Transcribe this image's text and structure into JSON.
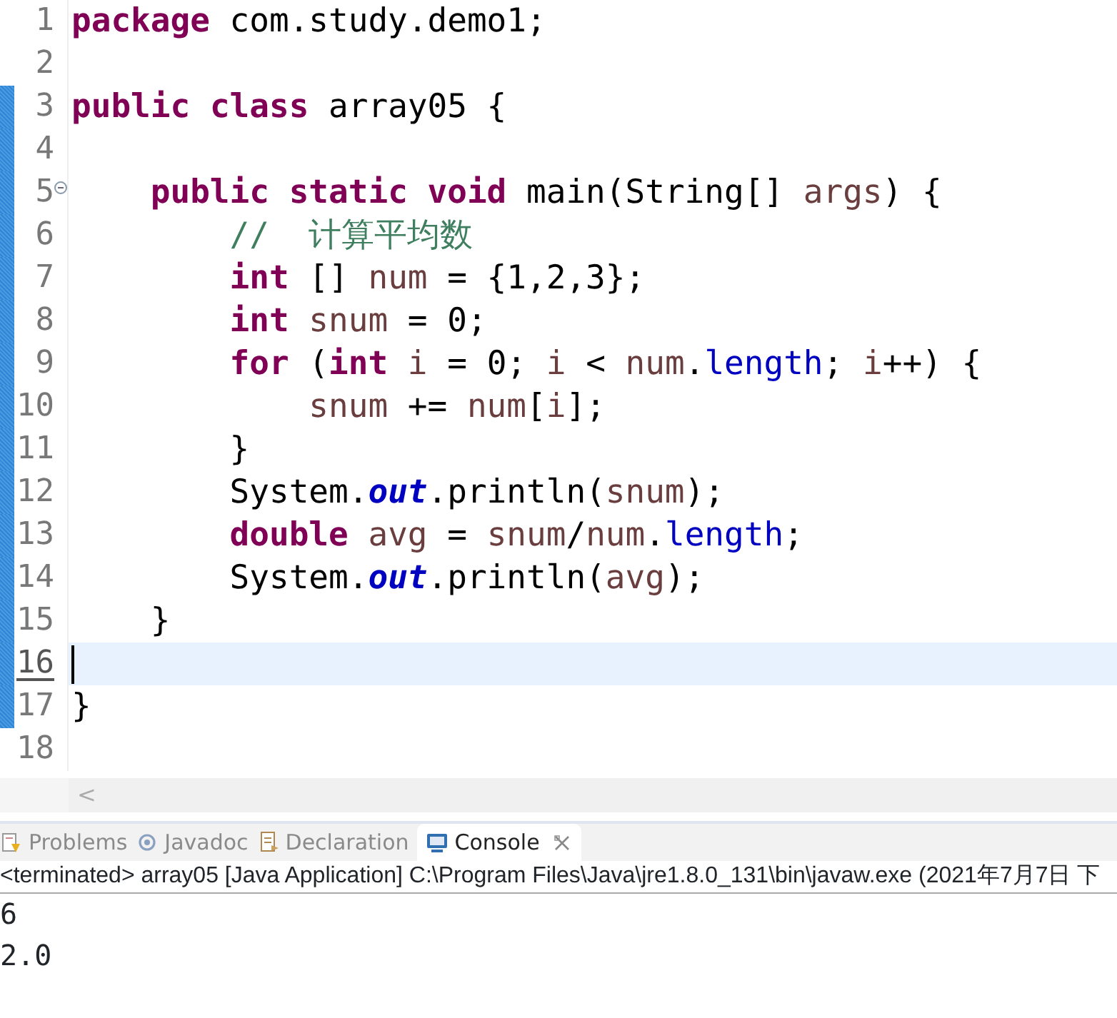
{
  "editor": {
    "lines": [
      {
        "number": "1",
        "marked": false,
        "current": false,
        "fold": false,
        "tokens": [
          {
            "kind": "keyword",
            "text": "package"
          },
          {
            "kind": "plain",
            "text": " com.study.demo1;"
          }
        ]
      },
      {
        "number": "2",
        "marked": false,
        "current": false,
        "fold": false
      },
      {
        "number": "3",
        "marked": true,
        "current": false,
        "fold": false,
        "tokens": [
          {
            "kind": "keyword",
            "text": "public"
          },
          {
            "kind": "keyword",
            "text": " class"
          },
          {
            "kind": "plain",
            "text": " array05 {"
          }
        ]
      },
      {
        "number": "4",
        "marked": true,
        "current": false,
        "fold": false
      },
      {
        "number": "5",
        "marked": true,
        "current": false,
        "fold": true,
        "tokens": [
          {
            "kind": "keyword",
            "text": "    public"
          },
          {
            "kind": "keyword",
            "text": " static"
          },
          {
            "kind": "keyword",
            "text": " void"
          },
          {
            "kind": "plain",
            "text": " main(String[] "
          },
          {
            "kind": "local",
            "text": "args"
          },
          {
            "kind": "plain",
            "text": ") {"
          }
        ]
      },
      {
        "number": "6",
        "marked": true,
        "current": false,
        "fold": false,
        "tokens": [
          {
            "kind": "comment",
            "text": "        //  计算平均数"
          }
        ]
      },
      {
        "number": "7",
        "marked": true,
        "current": false,
        "fold": false,
        "tokens": [
          {
            "kind": "keyword",
            "text": "        int"
          },
          {
            "kind": "plain",
            "text": " [] "
          },
          {
            "kind": "local",
            "text": "num"
          },
          {
            "kind": "plain",
            "text": " = {1,2,3};"
          }
        ]
      },
      {
        "number": "8",
        "marked": true,
        "current": false,
        "fold": false,
        "tokens": [
          {
            "kind": "keyword",
            "text": "        int"
          },
          {
            "kind": "local",
            "text": " snum"
          },
          {
            "kind": "plain",
            "text": " = 0;"
          }
        ]
      },
      {
        "number": "9",
        "marked": true,
        "current": false,
        "fold": false,
        "tokens": [
          {
            "kind": "keyword",
            "text": "        for"
          },
          {
            "kind": "plain",
            "text": " ("
          },
          {
            "kind": "keyword",
            "text": "int"
          },
          {
            "kind": "local",
            "text": " i"
          },
          {
            "kind": "plain",
            "text": " = 0; "
          },
          {
            "kind": "local",
            "text": "i"
          },
          {
            "kind": "plain",
            "text": " < "
          },
          {
            "kind": "local",
            "text": "num"
          },
          {
            "kind": "plain",
            "text": "."
          },
          {
            "kind": "field",
            "text": "length"
          },
          {
            "kind": "plain",
            "text": "; "
          },
          {
            "kind": "local",
            "text": "i"
          },
          {
            "kind": "plain",
            "text": "++) {"
          }
        ]
      },
      {
        "number": "10",
        "marked": true,
        "current": false,
        "fold": false,
        "tokens": [
          {
            "kind": "local",
            "text": "            snum"
          },
          {
            "kind": "plain",
            "text": " += "
          },
          {
            "kind": "local",
            "text": "num"
          },
          {
            "kind": "plain",
            "text": "["
          },
          {
            "kind": "local",
            "text": "i"
          },
          {
            "kind": "plain",
            "text": "];"
          }
        ]
      },
      {
        "number": "11",
        "marked": true,
        "current": false,
        "fold": false,
        "tokens": [
          {
            "kind": "plain",
            "text": "        }"
          }
        ]
      },
      {
        "number": "12",
        "marked": true,
        "current": false,
        "fold": false,
        "tokens": [
          {
            "kind": "plain",
            "text": "        System."
          },
          {
            "kind": "static_field",
            "text": "out"
          },
          {
            "kind": "plain",
            "text": ".println("
          },
          {
            "kind": "local",
            "text": "snum"
          },
          {
            "kind": "plain",
            "text": ");"
          }
        ]
      },
      {
        "number": "13",
        "marked": true,
        "current": false,
        "fold": false,
        "tokens": [
          {
            "kind": "keyword",
            "text": "        double"
          },
          {
            "kind": "local",
            "text": " avg"
          },
          {
            "kind": "plain",
            "text": " = "
          },
          {
            "kind": "local",
            "text": "snum"
          },
          {
            "kind": "plain",
            "text": "/"
          },
          {
            "kind": "local",
            "text": "num"
          },
          {
            "kind": "plain",
            "text": "."
          },
          {
            "kind": "field",
            "text": "length"
          },
          {
            "kind": "plain",
            "text": ";"
          }
        ]
      },
      {
        "number": "14",
        "marked": true,
        "current": false,
        "fold": false,
        "tokens": [
          {
            "kind": "plain",
            "text": "        System."
          },
          {
            "kind": "static_field",
            "text": "out"
          },
          {
            "kind": "plain",
            "text": ".println("
          },
          {
            "kind": "local",
            "text": "avg"
          },
          {
            "kind": "plain",
            "text": ");"
          }
        ]
      },
      {
        "number": "15",
        "marked": true,
        "current": false,
        "fold": false,
        "tokens": [
          {
            "kind": "plain",
            "text": "    }"
          }
        ]
      },
      {
        "number": "16",
        "marked": true,
        "current": true,
        "fold": false
      },
      {
        "number": "17",
        "marked": true,
        "current": false,
        "fold": false,
        "tokens": [
          {
            "kind": "plain",
            "text": "}"
          }
        ]
      },
      {
        "number": "18",
        "marked": false,
        "current": false,
        "fold": false
      }
    ],
    "scrollbar": {
      "left_arrow": "<"
    }
  },
  "tabs": [
    {
      "kind": "problems",
      "label": "Problems",
      "selected": false,
      "closable": false
    },
    {
      "kind": "javadoc",
      "label": "Javadoc",
      "selected": false,
      "closable": false
    },
    {
      "kind": "declaration",
      "label": "Declaration",
      "selected": false,
      "closable": false
    },
    {
      "kind": "console",
      "label": "Console",
      "selected": true,
      "closable": true
    }
  ],
  "console": {
    "status": "<terminated> array05 [Java Application] C:\\Program Files\\Java\\jre1.8.0_131\\bin\\javaw.exe (2021年7月7日 下",
    "output": [
      "6",
      "2.0"
    ]
  }
}
